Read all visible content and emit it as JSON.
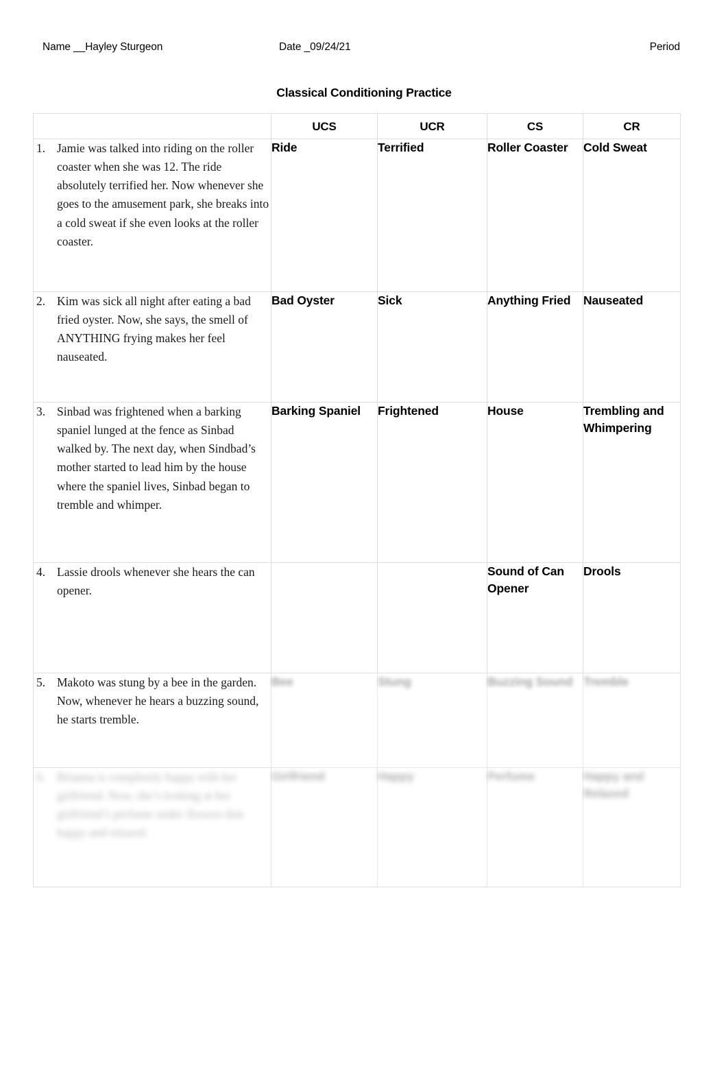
{
  "header": {
    "name_label": "Name __Hayley Sturgeon",
    "date_label": "Date _09/24/21",
    "period_label": "Period"
  },
  "title": "Classical Conditioning Practice",
  "table": {
    "columns": [
      {
        "key": "scenario",
        "label": ""
      },
      {
        "key": "ucs",
        "label": "UCS"
      },
      {
        "key": "ucr",
        "label": "UCR"
      },
      {
        "key": "cs",
        "label": "CS"
      },
      {
        "key": "cr",
        "label": "CR"
      }
    ],
    "rows": [
      {
        "number": "1.",
        "scenario": "Jamie was talked into riding on the roller coaster when she was 12. The ride absolutely terrified her. Now whenever she goes to the amusement park, she breaks into a cold sweat if she even looks at the roller coaster.",
        "ucs": "Ride",
        "ucr": "Terrified",
        "cs": "Roller Coaster",
        "cr": "Cold Sweat",
        "legible": true
      },
      {
        "number": "2.",
        "scenario": "Kim was sick all night after eating a bad fried oyster. Now, she says, the smell of ANYTHING frying makes her feel nauseated.",
        "ucs": "Bad Oyster",
        "ucr": "Sick",
        "cs": "Anything Fried",
        "cr": "Nauseated",
        "legible": true
      },
      {
        "number": "3.",
        "scenario": "Sinbad was frightened when a barking spaniel lunged at the fence as Sinbad walked by. The next day, when Sindbad’s mother started to lead him by the house where the spaniel lives, Sinbad began to tremble and whimper.",
        "ucs": "Barking Spaniel",
        "ucr": "Frightened",
        "cs": "House",
        "cr": "Trembling and Whimpering",
        "legible": true
      },
      {
        "number": "4.",
        "scenario": "Lassie drools whenever she hears the can opener.",
        "ucs": "",
        "ucr": "",
        "cs": "Sound of Can Opener",
        "cr": "Drools",
        "legible": true
      },
      {
        "number": "5.",
        "scenario": "Makoto was stung by a bee in the garden. Now, whenever he hears a buzzing sound, he starts tremble.",
        "ucs": "Bee",
        "ucr": "Stung",
        "cs": "Buzzing Sound",
        "cr": "Tremble",
        "legible": false,
        "answers_blurred": true
      },
      {
        "number": "6.",
        "scenario": "Brianna is completely happy with her girlfriend. Now, she’s looking at her girlfriend’s perfume under flowers that happy and relaxed.",
        "ucs": "Girlfriend",
        "ucr": "Happy",
        "cs": "Perfume",
        "cr": "Happy and Relaxed",
        "legible": false,
        "scenario_blurred": true,
        "answers_blurred": true
      }
    ]
  }
}
